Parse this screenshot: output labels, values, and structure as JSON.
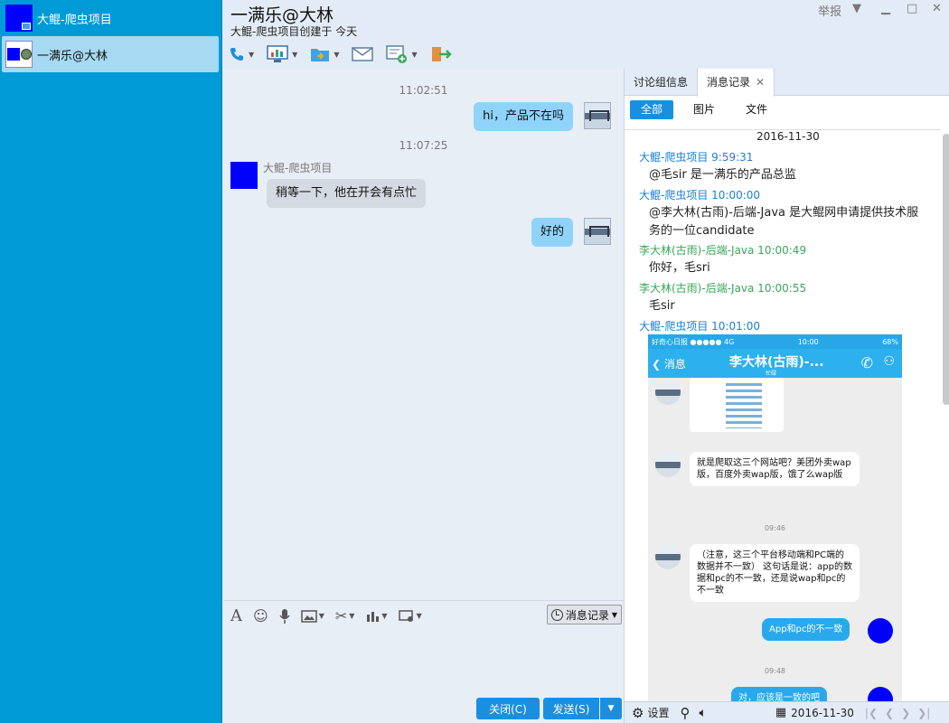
{
  "sidebar": {
    "items": [
      {
        "label": "大鲲-爬虫项目"
      },
      {
        "label": "一满乐@大林"
      }
    ]
  },
  "header": {
    "title": "一满乐@大林",
    "subtitle": "大鲲-爬虫项目创建于 今天",
    "report": "举报"
  },
  "chat": {
    "messages": [
      {
        "time": "11:02:51",
        "text": "hi，产品不在吗"
      },
      {
        "time": "11:07:25",
        "sender": "大鲲-爬虫项目",
        "text": "稍等一下，他在开会有点忙"
      },
      {
        "text": "好的"
      }
    ]
  },
  "input": {
    "history_label": "消息记录",
    "close_label": "关闭(C)",
    "send_label": "发送(S)"
  },
  "panel": {
    "tabs": [
      {
        "label": "讨论组信息"
      },
      {
        "label": "消息记录"
      }
    ],
    "filters": [
      {
        "label": "全部"
      },
      {
        "label": "图片"
      },
      {
        "label": "文件"
      }
    ],
    "date": "2016-11-30",
    "messages": [
      {
        "head": "大鲲-爬虫项目 9:59:31",
        "body": "@毛sir 是一满乐的产品总监"
      },
      {
        "head": "大鲲-爬虫项目 10:00:00",
        "body": "@李大林(古雨)-后端-Java 是大鲲网申请提供技术服务的一位candidate"
      },
      {
        "head": "李大林(古雨)-后端-Java 10:00:49",
        "body": "你好，毛sri"
      },
      {
        "head": "李大林(古雨)-后端-Java 10:00:55",
        "body": "毛sir"
      },
      {
        "head": "大鲲-爬虫项目 10:01:00"
      }
    ],
    "screenshot": {
      "status_left": "好奇心日报 ●●●●● 4G",
      "status_time": "10:00",
      "status_right": "68%",
      "back": "消息",
      "title": "李大林(古雨)-...",
      "subtitle": "忙碌",
      "bubble1": "就是爬取这三个网站吧？美团外卖wap版，百度外卖wap版，饿了么wap版",
      "time1": "09:46",
      "bubble2": "（注意，这三个平台移动端和PC端的数据并不一致） 这句话是说：app的数据和pc的不一致，还是说wap和pc的不一致",
      "bubble3": "App和pc的不一致",
      "time2": "09:48",
      "bubble4": "对，应该是一致的吧"
    },
    "footer": {
      "settings": "设置",
      "date": "2016-11-30"
    }
  },
  "colors": {
    "sidebar": "#009bd6",
    "accent": "#1a8fe0",
    "my_bubble": "#8fd3fb"
  }
}
